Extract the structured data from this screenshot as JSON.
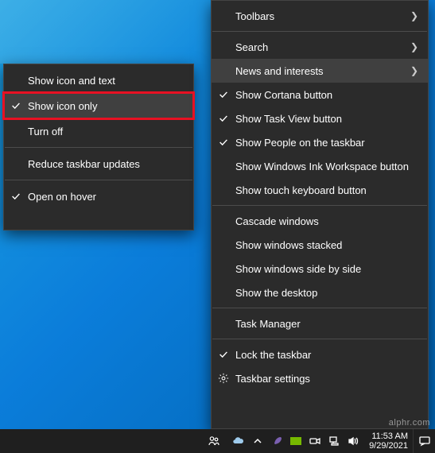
{
  "submenu": {
    "items": [
      {
        "label": "Show icon and text",
        "checked": false
      },
      {
        "label": "Show icon only",
        "checked": true,
        "highlighted": true
      },
      {
        "label": "Turn off",
        "checked": false
      }
    ],
    "extra1": "Reduce taskbar updates",
    "extra2": {
      "label": "Open on hover",
      "checked": true
    }
  },
  "menu": {
    "toolbars": "Toolbars",
    "search": "Search",
    "news": "News and interests",
    "cortana": "Show Cortana button",
    "taskview": "Show Task View button",
    "people": "Show People on the taskbar",
    "ink": "Show Windows Ink Workspace button",
    "touchkb": "Show touch keyboard button",
    "cascade": "Cascade windows",
    "stacked": "Show windows stacked",
    "sidebyside": "Show windows side by side",
    "desktop": "Show the desktop",
    "taskmgr": "Task Manager",
    "lock": "Lock the taskbar",
    "settings": "Taskbar settings"
  },
  "taskbar": {
    "time": "11:53 AM",
    "date": "9/29/2021"
  },
  "watermark": "alphr.com"
}
